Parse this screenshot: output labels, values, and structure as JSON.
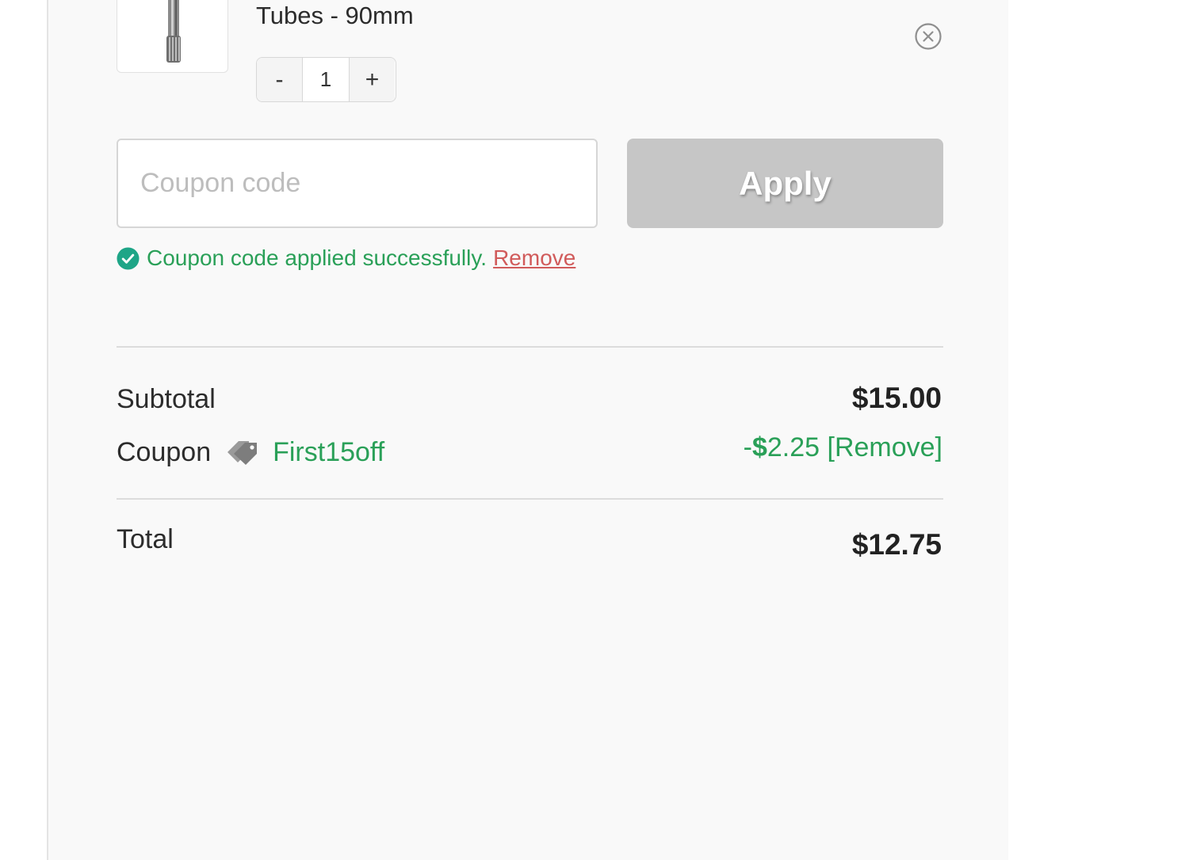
{
  "cart_item": {
    "name": "Tubes - 90mm",
    "quantity": "1",
    "decrement_label": "-",
    "increment_label": "+"
  },
  "coupon_form": {
    "placeholder": "Coupon code",
    "value": "",
    "apply_label": "Apply",
    "success_message": "Coupon code applied successfully.",
    "remove_label": "Remove"
  },
  "totals": {
    "subtotal_label": "Subtotal",
    "subtotal_value": "$15.00",
    "coupon_label": "Coupon",
    "coupon_code": "First15off",
    "discount_sign": "-",
    "discount_dollar": "$",
    "discount_amount": "2.25",
    "discount_remove_label": "[Remove]",
    "total_label": "Total",
    "total_value": "$12.75"
  },
  "colors": {
    "success_green": "#2aa058",
    "remove_red": "#d15b5b",
    "apply_button_bg": "#c6c6c6",
    "panel_bg": "#f9f9f9"
  },
  "icons": {
    "remove_item": "close-circle-icon",
    "success": "check-circle-icon",
    "coupon": "tag-icon"
  }
}
